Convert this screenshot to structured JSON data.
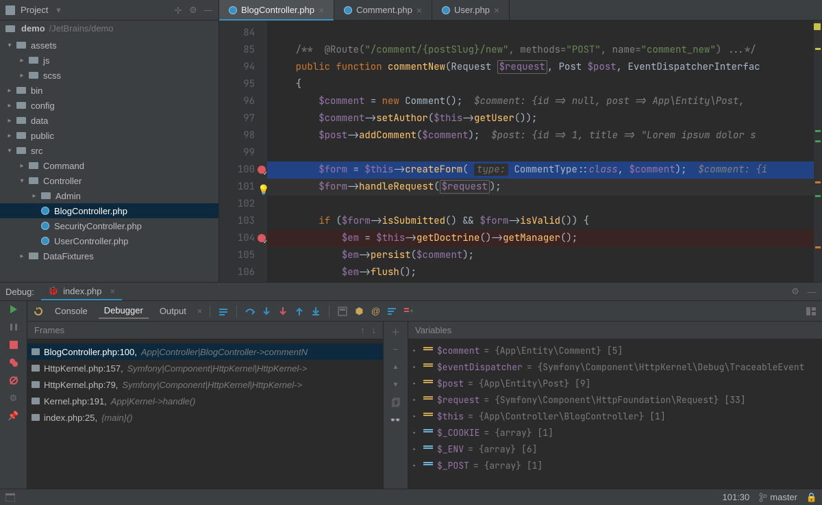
{
  "toolbar": {
    "project_label": "Project"
  },
  "breadcrumb": {
    "root": "demo",
    "path": "/JetBrains/demo"
  },
  "editor_tabs": [
    {
      "label": "BlogController.php",
      "active": true
    },
    {
      "label": "Comment.php",
      "active": false
    },
    {
      "label": "User.php",
      "active": false
    }
  ],
  "tree": {
    "items": [
      {
        "depth": 0,
        "arrow": "▾",
        "icon": "folder",
        "label": "assets"
      },
      {
        "depth": 1,
        "arrow": "▸",
        "icon": "folder",
        "label": "js"
      },
      {
        "depth": 1,
        "arrow": "▸",
        "icon": "folder",
        "label": "scss"
      },
      {
        "depth": 0,
        "arrow": "▸",
        "icon": "folder",
        "label": "bin"
      },
      {
        "depth": 0,
        "arrow": "▸",
        "icon": "folder",
        "label": "config"
      },
      {
        "depth": 0,
        "arrow": "▸",
        "icon": "folder",
        "label": "data"
      },
      {
        "depth": 0,
        "arrow": "▸",
        "icon": "folder",
        "label": "public"
      },
      {
        "depth": 0,
        "arrow": "▾",
        "icon": "folder",
        "label": "src"
      },
      {
        "depth": 1,
        "arrow": "▸",
        "icon": "folder",
        "label": "Command"
      },
      {
        "depth": 1,
        "arrow": "▾",
        "icon": "folder",
        "label": "Controller"
      },
      {
        "depth": 2,
        "arrow": "▸",
        "icon": "folder",
        "label": "Admin"
      },
      {
        "depth": 2,
        "arrow": "",
        "icon": "php",
        "label": "BlogController.php",
        "selected": true
      },
      {
        "depth": 2,
        "arrow": "",
        "icon": "php",
        "label": "SecurityController.php"
      },
      {
        "depth": 2,
        "arrow": "",
        "icon": "php",
        "label": "UserController.php"
      },
      {
        "depth": 1,
        "arrow": "▸",
        "icon": "folder",
        "label": "DataFixtures"
      }
    ]
  },
  "code": {
    "first_line": 84,
    "lines": [
      {
        "n": 84,
        "html": ""
      },
      {
        "n": 85,
        "html": "    <span class='tok-com'>/**</span>  <span class='tok-com'>@Route(</span><span class='tok-str'>\"/comment/{postSlug}/new\"</span><span class='tok-com'>, methods=</span><span class='tok-str'>\"POST\"</span><span class='tok-com'>, name=</span><span class='tok-str'>\"comment_new\"</span><span class='tok-com'>) ...*/</span>"
      },
      {
        "n": 94,
        "html": "    <span class='tok-kw'>public function</span> <span class='tok-fn'>commentNew</span><span class='tok-txt'>(Request </span><span class='tok-var box-var'>$request</span><span class='tok-txt'>, Post </span><span class='tok-var'>$post</span><span class='tok-txt'>, EventDispatcherInterfac</span>"
      },
      {
        "n": 95,
        "html": "    <span class='tok-txt'>{</span>"
      },
      {
        "n": 96,
        "html": "        <span class='tok-var'>$comment</span> <span class='tok-txt'>=</span> <span class='tok-kw'>new</span> <span class='tok-txt'>Comment();</span>  <span class='tok-com-it'>$comment: {id =&gt; null, post =&gt; App\\Entity\\Post, </span>"
      },
      {
        "n": 97,
        "html": "        <span class='tok-var'>$comment</span><span class='tok-txt'>-&gt;</span><span class='tok-fn'>setAuthor</span><span class='tok-txt'>(</span><span class='tok-var'>$this</span><span class='tok-txt'>-&gt;</span><span class='tok-fn'>getUser</span><span class='tok-txt'>());</span>"
      },
      {
        "n": 98,
        "html": "        <span class='tok-var'>$post</span><span class='tok-txt'>-&gt;</span><span class='tok-fn'>addComment</span><span class='tok-txt'>(</span><span class='tok-var'>$comment</span><span class='tok-txt'>);</span>  <span class='tok-com-it'>$post: {id =&gt; 1, title =&gt; \"Lorem ipsum dolor s</span>"
      },
      {
        "n": 99,
        "html": ""
      },
      {
        "n": 100,
        "bp": true,
        "hl": "blue",
        "html": "        <span class='tok-var'>$form</span> <span class='tok-txt'>=</span> <span class='tok-var'>$this</span><span class='tok-txt'>-&gt;</span><span class='tok-fn'>createForm</span><span class='tok-txt'>(</span> <span class='tok-hint'>type:</span> <span class='tok-txt'>CommentType::</span><span class='tok-const'>class</span><span class='tok-txt'>, </span><span class='tok-var'>$comment</span><span class='tok-txt'>);</span>  <span class='tok-com-it'>$comment: {i</span>"
      },
      {
        "n": 101,
        "bulb": true,
        "hl": "cur",
        "html": "        <span class='tok-var'>$form</span><span class='tok-txt'>-&gt;</span><span class='tok-fn'>handleRequest</span><span class='tok-txt'>(</span><span class='tok-var box-var'>$request</span><span class='tok-txt'>);</span>"
      },
      {
        "n": 102,
        "html": ""
      },
      {
        "n": 103,
        "html": "        <span class='tok-kw'>if</span> <span class='tok-txt'>(</span><span class='tok-var'>$form</span><span class='tok-txt'>-&gt;</span><span class='tok-fn'>isSubmitted</span><span class='tok-txt'>() &amp;&amp; </span><span class='tok-var'>$form</span><span class='tok-txt'>-&gt;</span><span class='tok-fn'>isValid</span><span class='tok-txt'>()) {</span>"
      },
      {
        "n": 104,
        "bp": true,
        "hl": "red",
        "html": "            <span class='tok-var'>$em</span> <span class='tok-txt'>=</span> <span class='tok-var'>$this</span><span class='tok-txt'>-&gt;</span><span class='tok-fn'>getDoctrine</span><span class='tok-txt'>()-&gt;</span><span class='tok-fn'>getManager</span><span class='tok-txt'>();</span>"
      },
      {
        "n": 105,
        "html": "            <span class='tok-var'>$em</span><span class='tok-txt'>-&gt;</span><span class='tok-fn'>persist</span><span class='tok-txt'>(</span><span class='tok-var'>$comment</span><span class='tok-txt'>);</span>"
      },
      {
        "n": 106,
        "html": "            <span class='tok-var'>$em</span><span class='tok-txt'>-&gt;</span><span class='tok-fn'>flush</span><span class='tok-txt'>();</span>"
      }
    ]
  },
  "debug": {
    "title": "Debug:",
    "tab": "index.php",
    "subtabs": {
      "console": "Console",
      "debugger": "Debugger",
      "output": "Output"
    },
    "frames_title": "Frames",
    "vars_title": "Variables",
    "frames": [
      {
        "loc": "BlogController.php:100,",
        "ctx": "App|Controller|BlogController->commentN",
        "selected": true
      },
      {
        "loc": "HttpKernel.php:157,",
        "ctx": "Symfony|Component|HttpKernel|HttpKernel->"
      },
      {
        "loc": "HttpKernel.php:79,",
        "ctx": "Symfony|Component|HttpKernel|HttpKernel->"
      },
      {
        "loc": "Kernel.php:191,",
        "ctx": "App|Kernel->handle()"
      },
      {
        "loc": "index.php:25,",
        "ctx": "{main}()"
      }
    ],
    "variables": [
      {
        "icon": "orange",
        "name": "$comment",
        "val": "= {App\\Entity\\Comment} [5]"
      },
      {
        "icon": "orange",
        "name": "$eventDispatcher",
        "val": "= {Symfony\\Component\\HttpKernel\\Debug\\TraceableEvent"
      },
      {
        "icon": "orange",
        "name": "$post",
        "val": "= {App\\Entity\\Post} [9]"
      },
      {
        "icon": "orange",
        "name": "$request",
        "val": "= {Symfony\\Component\\HttpFoundation\\Request} [33]"
      },
      {
        "icon": "orange",
        "name": "$this",
        "val": "= {App\\Controller\\BlogController} [1]"
      },
      {
        "icon": "blue",
        "name": "$_COOKIE",
        "val": "= {array} [1]"
      },
      {
        "icon": "blue",
        "name": "$_ENV",
        "val": "= {array} [6]"
      },
      {
        "icon": "blue",
        "name": "$_POST",
        "val": "= {array} [1]"
      }
    ]
  },
  "status": {
    "pos": "101:30",
    "branch": "master"
  }
}
